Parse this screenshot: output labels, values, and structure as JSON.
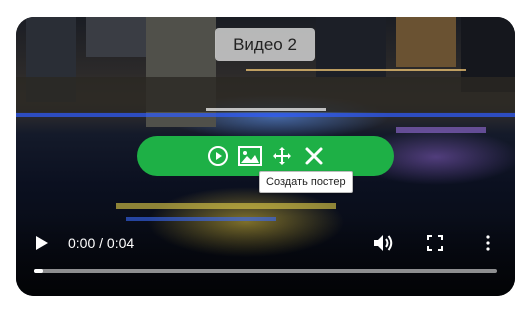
{
  "video": {
    "title": "Видео 2",
    "current_time": "0:00",
    "separator": " / ",
    "duration": "0:04",
    "progress_fraction": 0.02
  },
  "toolbar": {
    "accent_color": "#1eb046",
    "buttons": [
      {
        "icon": "play-circle-icon"
      },
      {
        "icon": "image-icon"
      },
      {
        "icon": "move-icon"
      },
      {
        "icon": "close-icon"
      }
    ],
    "tooltip": "Создать постер"
  },
  "controls": {
    "icons": [
      "play-icon",
      "volume-icon",
      "fullscreen-icon",
      "more-vert-icon"
    ]
  }
}
